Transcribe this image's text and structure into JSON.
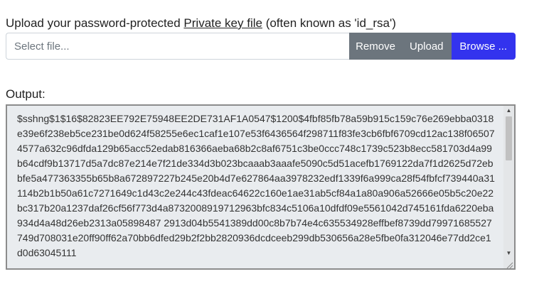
{
  "upload": {
    "label_prefix": "Upload your password-protected ",
    "label_link": "Private key file",
    "label_suffix": " (often known as 'id_rsa')",
    "file_placeholder": "Select file...",
    "remove_label": "Remove",
    "upload_label": "Upload",
    "browse_label": "Browse ..."
  },
  "output": {
    "label": "Output:",
    "text": "$sshng$1$16$82823EE792E75948EE2DE731AF1A0547$1200$4fbf85fb78a59b915c159c76e269ebba0318e39e6f238eb5ce231be0d624f58255e6ec1caf1e107e53f6436564f298711f83fe3cb6fbf6709cd12ac138f065074577a632c96dfda129b65acc52edab816366aeba68b2c8af6751c3be0ccc748c1739c523b8ecc581703d4a99b64cdf9b13717d5a7dc87e214e7f21de334d3b023bcaaab3aaafe5090c5d51acefb1769122da7f1d2625d72ebbfe5a477363355b65b8a672897227b245e20b4d7e627864aa3978232edf1339f6a999ca28f54fbfcf739440a31114b2b1b50a61c7271649c1d43c2e244c43fdeac64622c160e1ae31ab5cf84a1a80a906a52666e05b5c20e22bc317b20a1237daf26cf56f773d4a8732008919712963bfc834c5106a10dfdf09e5561042d745161fda6220eba934d4a48d26eb2313a05898487 2913d04b5541389dd00c8b7b74e4c635534928effbef8739dd79971685527749d708031e20ff90ff62a70bb6dfed29b2f2bb2820936dcdceeb299db530656a28e5fbe0fa312046e77dd2ce1d0d63045111"
  },
  "colors": {
    "browse": "#3333ee",
    "secondary": "#6c757d",
    "output_bg": "#e9ecef"
  },
  "icons": {
    "scroll_up": "triangle-up-icon",
    "scroll_down": "triangle-down-icon",
    "resize": "resize-grip-icon"
  }
}
